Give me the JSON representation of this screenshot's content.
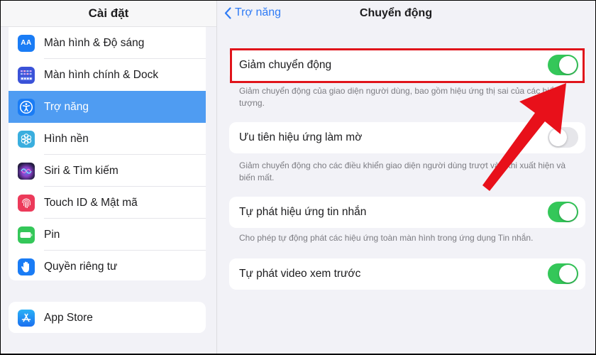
{
  "sidebar": {
    "title": "Cài đặt",
    "items": [
      {
        "label": "Màn hình & Độ sáng",
        "icon": "display-brightness-icon",
        "color": "#1a7cf5",
        "active": false
      },
      {
        "label": "Màn hình chính & Dock",
        "icon": "home-screen-dock-icon",
        "color": "#3a52d8",
        "active": false
      },
      {
        "label": "Trợ năng",
        "icon": "accessibility-icon",
        "color": "#1a7cf5",
        "active": true
      },
      {
        "label": "Hình nền",
        "icon": "wallpaper-icon",
        "color": "#3aaede",
        "active": false
      },
      {
        "label": "Siri & Tìm kiếm",
        "icon": "siri-icon",
        "color": "#2b1f4f",
        "active": false
      },
      {
        "label": "Touch ID & Mật mã",
        "icon": "fingerprint-icon",
        "color": "#ec3a5a",
        "active": false
      },
      {
        "label": "Pin",
        "icon": "battery-icon",
        "color": "#34c759",
        "active": false
      },
      {
        "label": "Quyền riêng tư",
        "icon": "privacy-hand-icon",
        "color": "#1a7cf5",
        "active": false
      }
    ],
    "secondary_items": [
      {
        "label": "App Store",
        "icon": "app-store-icon",
        "color": "#1f8ef1"
      }
    ]
  },
  "main": {
    "back_label": "Trợ năng",
    "title": "Chuyển động",
    "settings": [
      {
        "label": "Giảm chuyển động",
        "enabled": true,
        "highlighted": true,
        "description": "Giảm chuyển động của giao diện người dùng, bao gồm hiệu ứng thị sai của các biểu tượng."
      },
      {
        "label": "Ưu tiên hiệu ứng làm mờ",
        "enabled": false,
        "highlighted": false,
        "description": "Giảm chuyển động cho các điều khiển giao diện người dùng trượt vào khi xuất hiện và biến mất."
      },
      {
        "label": "Tự phát hiệu ứng tin nhắn",
        "enabled": true,
        "highlighted": false,
        "description": "Cho phép tự động phát các hiệu ứng toàn màn hình trong ứng dụng Tin nhắn."
      },
      {
        "label": "Tự phát video xem trước",
        "enabled": true,
        "highlighted": false,
        "description": ""
      }
    ]
  },
  "annotation": {
    "highlight_color": "#e0141b",
    "arrow_color": "#e8101a",
    "arrow_target": "Giảm chuyển động toggle"
  },
  "colors": {
    "accent": "#2f7bf5",
    "toggle_on": "#34c759",
    "toggle_off": "#e6e6ea",
    "selection": "#4f9cf2",
    "background": "#f2f2f7"
  }
}
